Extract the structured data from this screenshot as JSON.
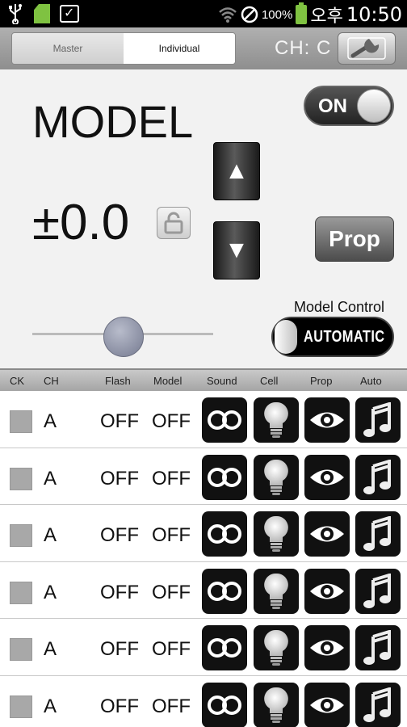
{
  "status_bar": {
    "battery_percent": "100%",
    "ampm": "오후",
    "time": "10:50",
    "icons": [
      "usb-icon",
      "sd-card-icon",
      "task-icon",
      "wifi-icon",
      "do-not-disturb-icon",
      "battery-icon"
    ]
  },
  "tabs": {
    "master": "Master",
    "individual": "Individual",
    "selected": "Individual"
  },
  "channel_label": "CH: C",
  "panel": {
    "title": "MODEL",
    "value": "±0.0",
    "on_toggle": "ON",
    "prop_button": "Prop",
    "model_control_label": "Model Control",
    "model_control_value": "AUTOMATIC",
    "slider_level": 0.5
  },
  "columns": [
    "CK",
    "CH",
    "Flash",
    "Model",
    "Sound",
    "Cell",
    "Prop",
    "Auto"
  ],
  "rows": [
    {
      "ch": "A",
      "flash": "OFF",
      "model": "OFF"
    },
    {
      "ch": "A",
      "flash": "OFF",
      "model": "OFF"
    },
    {
      "ch": "A",
      "flash": "OFF",
      "model": "OFF"
    },
    {
      "ch": "A",
      "flash": "OFF",
      "model": "OFF"
    },
    {
      "ch": "A",
      "flash": "OFF",
      "model": "OFF"
    },
    {
      "ch": "A",
      "flash": "OFF",
      "model": "OFF"
    }
  ]
}
